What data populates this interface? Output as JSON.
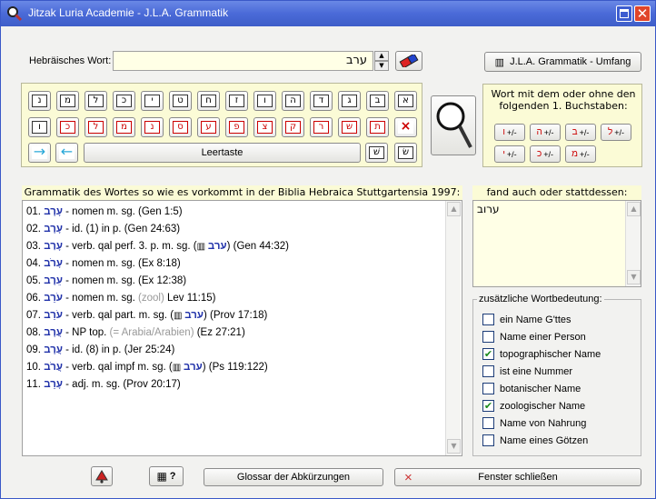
{
  "window": {
    "title": "Jitzak Luria Academie - J.L.A. Grammatik"
  },
  "search": {
    "label": "Hebräisches Wort:",
    "value": "ערב"
  },
  "umfang_button": "J.L.A. Grammatik - Umfang",
  "keyboard": {
    "row1": [
      "ק",
      "ר",
      "ש",
      "ת",
      "א",
      "ב",
      "ג",
      "ד",
      "ה",
      "ו",
      "ז",
      "ח",
      "ט",
      "י"
    ],
    "row1_display": [
      "א",
      "ב",
      "ג",
      "ד",
      "ה",
      "ו",
      "ז",
      "ח",
      "ט",
      "י",
      "כ",
      "ל",
      "מ",
      "נ"
    ],
    "row2": [
      "ו",
      "כ",
      "ל",
      "מ",
      "נ",
      "ס",
      "ע",
      "פ",
      "צ",
      "ק",
      "ר",
      "ש",
      "ת",
      "×"
    ],
    "space_label": "Leertaste",
    "arrow_right": "→",
    "arrow_left": "←",
    "shin_left": "שׁ",
    "shin_right": "שׂ"
  },
  "letters_panel": {
    "label": "Wort mit dem oder ohne den folgenden 1. Buchstaben:",
    "keys": [
      {
        "letter": "ו",
        "suffix": "+/-"
      },
      {
        "letter": "ה",
        "suffix": "+/-"
      },
      {
        "letter": "ב",
        "suffix": "+/-"
      },
      {
        "letter": "ל",
        "suffix": "+/-"
      },
      {
        "letter": "י",
        "suffix": "+/-"
      },
      {
        "letter": "כ",
        "suffix": "+/-"
      },
      {
        "letter": "מ",
        "suffix": "+/-"
      }
    ]
  },
  "results": {
    "header": "Grammatik des Wortes so wie es vorkommt in der Biblia Hebraica Stuttgartensia 1997:",
    "rows": [
      {
        "num": "01.",
        "heb": "עָרָב",
        "text": " - nomen m. sg. (Gen 1:5)"
      },
      {
        "num": "02.",
        "heb": "עָרָב",
        "text": " - id. (1) in p. (Gen 24:63)"
      },
      {
        "num": "03.",
        "heb": "עָרַב",
        "text": " - verb. qal perf. 3. p. m. sg. (",
        "ref_heb": "ערב",
        "ref": ") (Gen 44:32)"
      },
      {
        "num": "04.",
        "heb": "עָרֹב",
        "text": " - nomen m. sg. (Ex 8:18)"
      },
      {
        "num": "05.",
        "heb": "עֵרֶב",
        "text": " - nomen m. sg. (Ex 12:38)"
      },
      {
        "num": "06.",
        "heb": "עֹרֵב",
        "text": " - nomen m. sg. ",
        "grey": "(zool)",
        "tail": " Lev 11:15)"
      },
      {
        "num": "07.",
        "heb": "עֹרֵב",
        "text": " - verb. qal part. m. sg. (",
        "ref_heb": "ערב",
        "ref": ") (Prov 17:18)"
      },
      {
        "num": "08.",
        "heb": "עֲרָב",
        "text": " - NP top. ",
        "grey": "(= Arabia/Arabien)",
        "tail": " (Ez 27:21)"
      },
      {
        "num": "09.",
        "heb": "עֲרָב",
        "text": " - id. (8) in p. (Jer 25:24)"
      },
      {
        "num": "10.",
        "heb": "עֲרֹב",
        "text": " - verb. qal impf m. sg. (",
        "ref_heb": "ערב",
        "ref": ") (Ps 119:122)"
      },
      {
        "num": "11.",
        "heb": "עָרֵב",
        "text": " - adj. m. sg. (Prov 20:17)"
      }
    ]
  },
  "alternatives": {
    "header": "fand auch oder stattdessen:",
    "value": "ערוב"
  },
  "meanings": {
    "legend": "zusätzliche Wortbedeutung:",
    "items": [
      {
        "label": "ein Name G'ttes",
        "checked": false
      },
      {
        "label": "Name einer Person",
        "checked": false
      },
      {
        "label": "topographischer Name",
        "checked": true
      },
      {
        "label": "ist eine Nummer",
        "checked": false
      },
      {
        "label": "botanischer Name",
        "checked": false
      },
      {
        "label": "zoologischer Name",
        "checked": true
      },
      {
        "label": "Name von Nahrung",
        "checked": false
      },
      {
        "label": "Name eines Götzen",
        "checked": false
      }
    ]
  },
  "bottom": {
    "help_label": "?",
    "glossar": "Glossar der Abkürzungen",
    "close_icon": "×",
    "close": "Fenster schließen"
  }
}
